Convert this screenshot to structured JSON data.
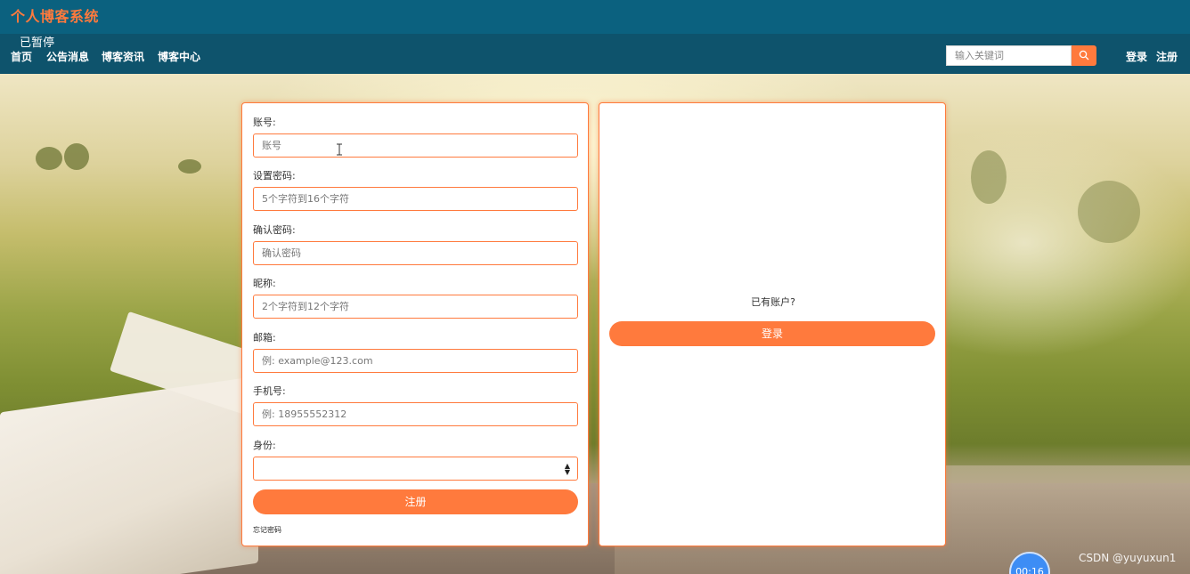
{
  "header": {
    "site_title": "个人博客系统",
    "paused_text": "已暂停"
  },
  "nav": {
    "items": [
      {
        "label": "首页"
      },
      {
        "label": "公告消息"
      },
      {
        "label": "博客资讯"
      },
      {
        "label": "博客中心"
      }
    ],
    "search_placeholder": "输入关键词",
    "login_label": "登录",
    "register_label": "注册"
  },
  "register_form": {
    "account_label": "账号:",
    "account_placeholder": "账号",
    "password_label": "设置密码:",
    "password_placeholder": "5个字符到16个字符",
    "confirm_label": "确认密码:",
    "confirm_placeholder": "确认密码",
    "nickname_label": "昵称:",
    "nickname_placeholder": "2个字符到12个字符",
    "email_label": "邮箱:",
    "email_placeholder": "例: example@123.com",
    "phone_label": "手机号:",
    "phone_placeholder": "例: 18955552312",
    "role_label": "身份:",
    "role_value": "",
    "submit_label": "注册",
    "forgot_label": "忘记密码"
  },
  "login_panel": {
    "prompt": "已有账户?",
    "login_button": "登录"
  },
  "overlay": {
    "timer": "00:16",
    "watermark": "CSDN @yuyuxun1"
  },
  "colors": {
    "accent": "#ff7a3d",
    "header_bg": "#0b617f",
    "nav_bg": "#0e536c"
  }
}
